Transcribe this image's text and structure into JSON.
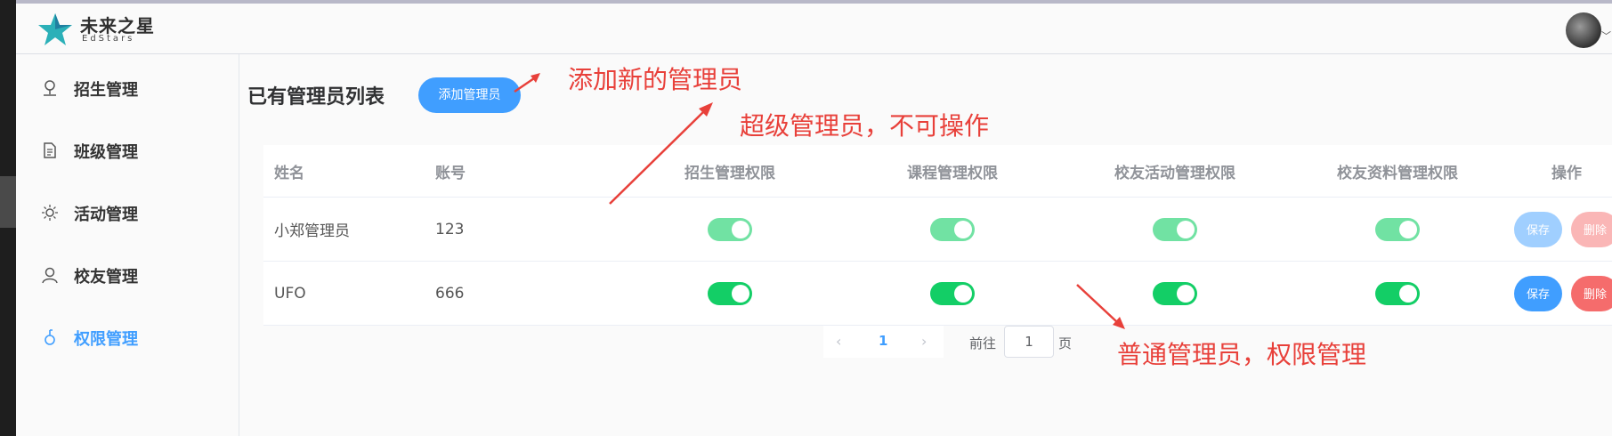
{
  "app": {
    "logo_text": "未来之星",
    "logo_sub": "EdStars",
    "brand_color": "#2bb0b8"
  },
  "sidebar": {
    "items": [
      {
        "label": "招生管理",
        "icon": "user-pin-icon",
        "active": false
      },
      {
        "label": "班级管理",
        "icon": "document-icon",
        "active": false
      },
      {
        "label": "活动管理",
        "icon": "sun-icon",
        "active": false
      },
      {
        "label": "校友管理",
        "icon": "user-icon",
        "active": false
      },
      {
        "label": "权限管理",
        "icon": "key-icon",
        "active": true
      }
    ],
    "active_color": "#409eff"
  },
  "main": {
    "title": "已有管理员列表",
    "add_button": "添加管理员"
  },
  "table": {
    "headers": [
      "姓名",
      "账号",
      "招生管理权限",
      "课程管理权限",
      "校友活动管理权限",
      "校友资料管理权限",
      "操作"
    ],
    "rows": [
      {
        "name": "小郑管理员",
        "account": "123",
        "perms": [
          true,
          true,
          true,
          true
        ],
        "disabled": true,
        "save": "保存",
        "delete": "删除"
      },
      {
        "name": "UFO",
        "account": "666",
        "perms": [
          true,
          true,
          true,
          true
        ],
        "disabled": false,
        "save": "保存",
        "delete": "删除"
      }
    ]
  },
  "pagination": {
    "current": "1",
    "goto_label": "前往",
    "goto_value": "1",
    "goto_suffix": "页"
  },
  "annotations": {
    "add_note": "添加新的管理员",
    "super_note": "超级管理员，不可操作",
    "normal_note": "普通管理员，权限管理",
    "color": "#e8403a"
  }
}
